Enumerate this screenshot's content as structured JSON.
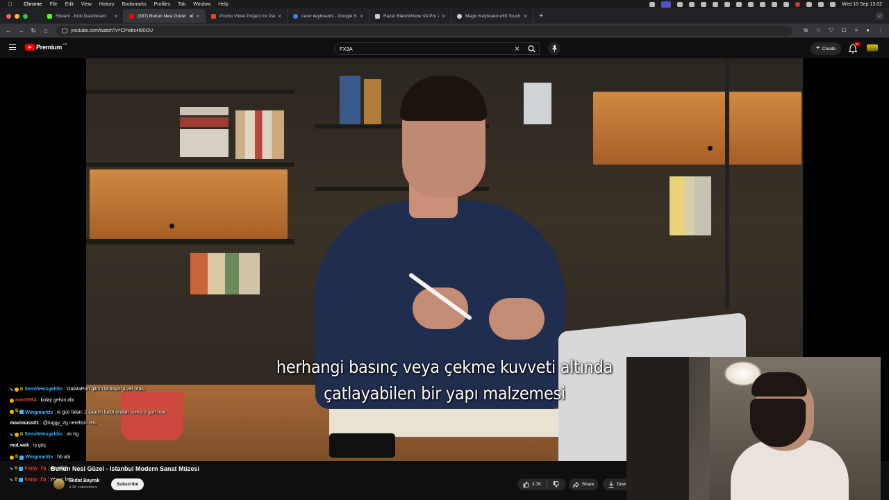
{
  "menubar": {
    "app": "Chrome",
    "items": [
      "File",
      "Edit",
      "View",
      "History",
      "Bookmarks",
      "Profiles",
      "Tab",
      "Window",
      "Help"
    ],
    "clock": "Wed 10 Sep  13:02"
  },
  "tabs": [
    {
      "title": "Stream - Kick Dashboard",
      "favicon_color": "#53fc18"
    },
    {
      "title": "(337) Bunun Nesi Güzel",
      "favicon_color": "#ff0000",
      "active": true
    },
    {
      "title": "Promo Video Project for Park",
      "favicon_color": "#ea4335"
    },
    {
      "title": "razer keyboards - Google Se",
      "favicon_color": "#4285f4"
    },
    {
      "title": "Razer BlackWidow V4 Pro 75",
      "favicon_color": "#cccccc"
    },
    {
      "title": "Magic Keyboard with Touch I",
      "favicon_color": "#cccccc"
    }
  ],
  "address_bar": {
    "url": "youtube.com/watch?v=CPwbs4t90OU"
  },
  "youtube": {
    "logo_text": "Premium",
    "logo_country": "GB",
    "search_value": "FX3A",
    "create_label": "Create",
    "notification_count": "9+"
  },
  "video": {
    "subtitle_line1": "herhangi basınç veya çekme kuvveti altında",
    "subtitle_line2": "çatlayabilen bir yapı malzemesi",
    "title": "Bunun Nesi Güzel - Istanbul Modern Sanat Müzesi",
    "channel_name": "Sedat Bayrak",
    "channel_subs": "4.3K subscribers",
    "subscribe_label": "Subscribe",
    "likes": "3.7K",
    "share_label": "Share",
    "download_label": "Dow"
  },
  "chat": [
    {
      "user": "SemihHosgeldin",
      "color": "#3fb4ff",
      "message": "GalataPort gittim la baya güzel orasi",
      "badges": [
        "sword",
        "gold",
        "b"
      ]
    },
    {
      "user": "mert3564",
      "color": "#e8432d",
      "message": "kolay gelsin abi",
      "badges": [
        "gold"
      ]
    },
    {
      "user": "Wingmanttv",
      "color": "#3fb4ff",
      "message": "is guc falan. 2 saatim kaldi ondan sonra 3 gun free",
      "badges": [
        "gold",
        "b",
        "cube"
      ],
      "wrap": true
    },
    {
      "user": "maximuss01",
      "color": "#ffffff",
      "message": "@tuggy_2g nerelisin reis",
      "badges": []
    },
    {
      "user": "SemihHosgeldin",
      "color": "#3fb4ff",
      "message": "as hg",
      "badges": [
        "sword",
        "gold",
        "b"
      ]
    },
    {
      "user": "moLwak",
      "color": "#ffffff",
      "message": "iş güç",
      "badges": []
    },
    {
      "user": "Wingmanttv",
      "color": "#3fb4ff",
      "message": "hb abi",
      "badges": [
        "gold",
        "b",
        "cube"
      ]
    },
    {
      "user": "tuggy_2g",
      "color": "#e8432d",
      "message": "eyvallah",
      "badges": [
        "sword",
        "b",
        "cube"
      ]
    },
    {
      "user": "tuggy_2g",
      "color": "#e8432d",
      "message": "yeagg bee",
      "badges": [
        "sword",
        "b",
        "cube"
      ]
    }
  ]
}
